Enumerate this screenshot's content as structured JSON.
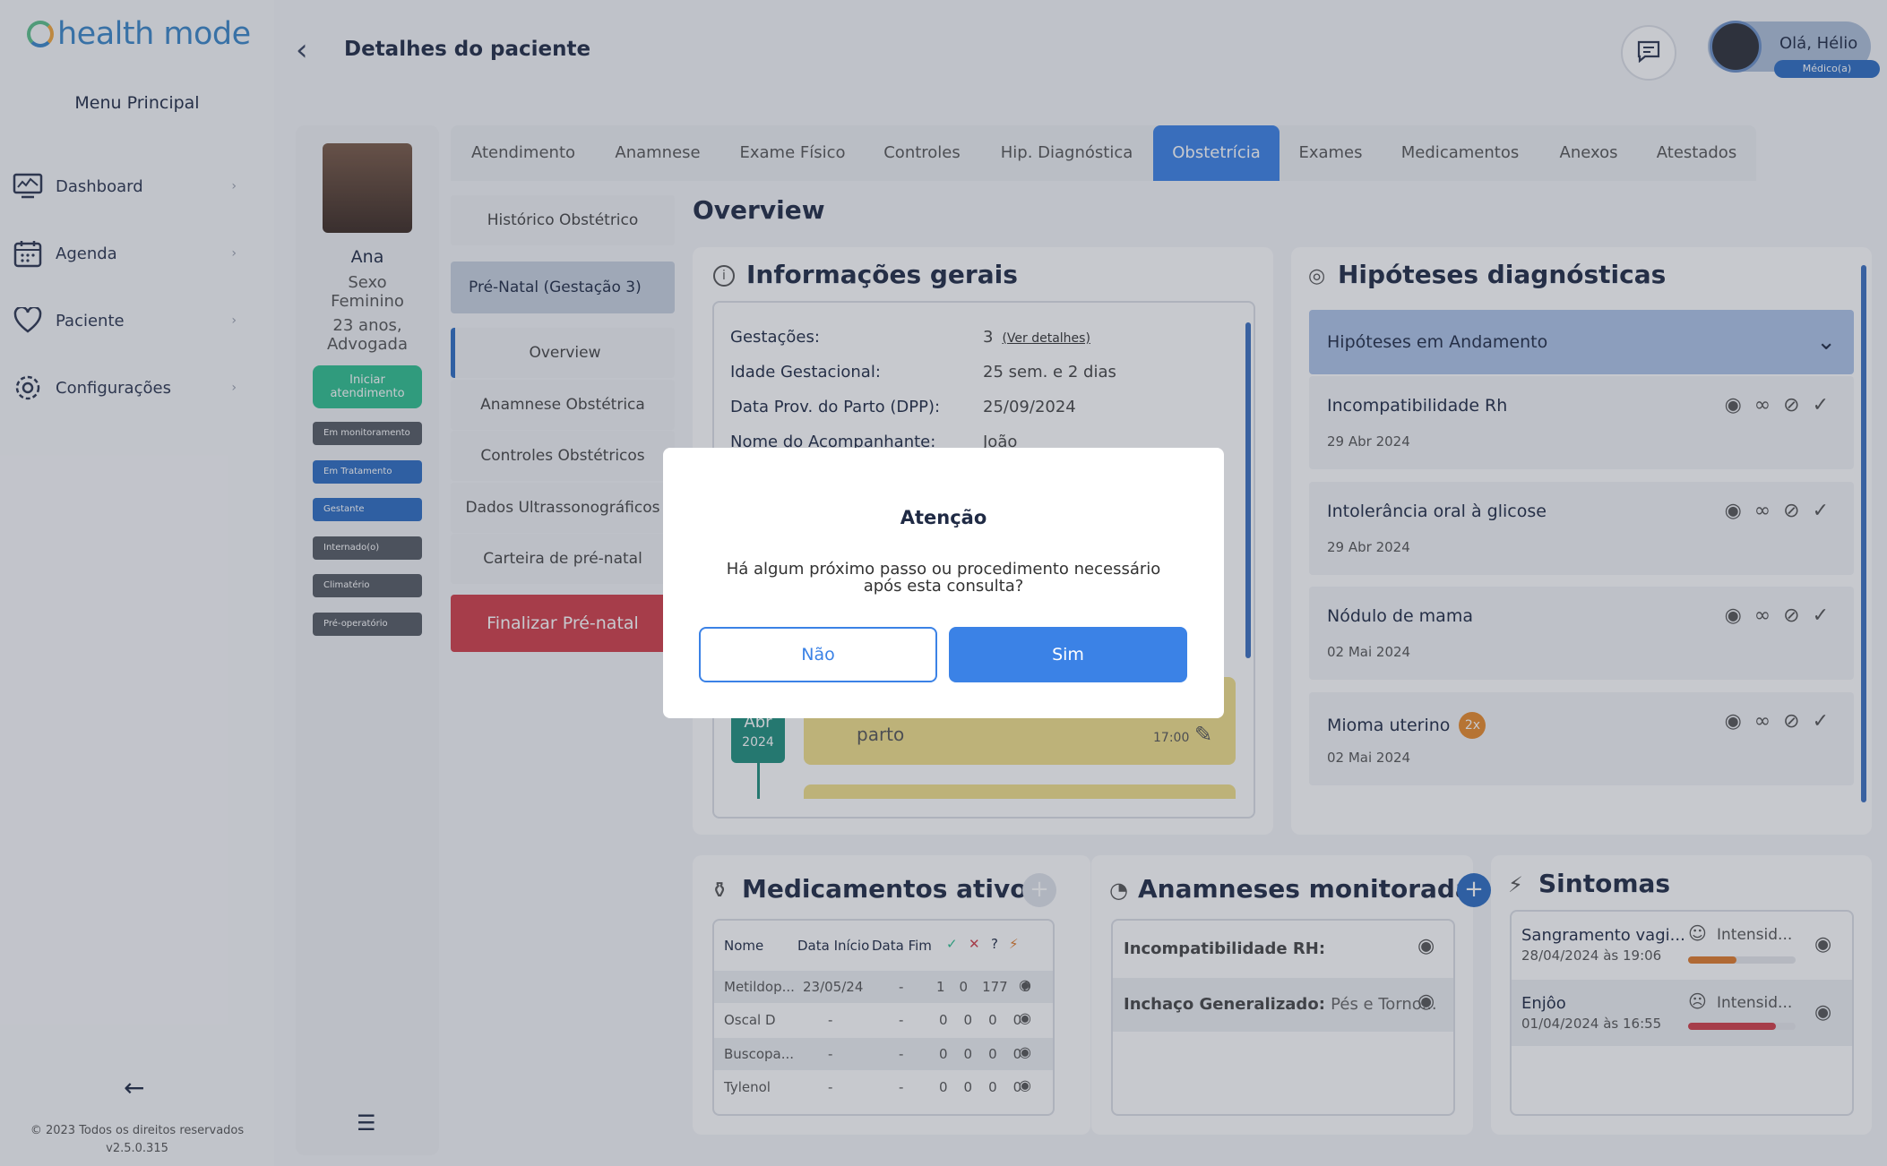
{
  "app": {
    "logo_text": "health mode",
    "menu_title": "Menu Principal"
  },
  "sidebar": {
    "items": [
      {
        "label": "Dashboard",
        "icon": "monitor-icon"
      },
      {
        "label": "Agenda",
        "icon": "calendar-icon"
      },
      {
        "label": "Paciente",
        "icon": "heart-icon"
      },
      {
        "label": "Configurações",
        "icon": "gear-icon"
      }
    ],
    "copyright": "© 2023 Todos os direitos reservados",
    "version": "v2.5.0.315"
  },
  "header": {
    "title": "Detalhes do paciente",
    "greeting": "Olá, Hélio",
    "role": "Médico(a)"
  },
  "patient": {
    "name": "Ana",
    "sex_label": "Sexo",
    "sex": "Feminino",
    "age_job": "23 anos,",
    "job": "Advogada",
    "start_button": "Iniciar atendimento",
    "tags": [
      "Em monitoramento",
      "Em Tratamento",
      "Gestante",
      "Internado(o)",
      "Climatério",
      "Pré-operatório"
    ]
  },
  "tabs": [
    "Atendimento",
    "Anamnese",
    "Exame Físico",
    "Controles",
    "Hip. Diagnóstica",
    "Obstetrícia",
    "Exames",
    "Medicamentos",
    "Anexos",
    "Atestados"
  ],
  "obst_menu": {
    "historico": "Histórico Obstétrico",
    "prenatal": "Pré-Natal (Gestação 3)",
    "items": [
      "Overview",
      "Anamnese Obstétrica",
      "Controles Obstétricos",
      "Dados Ultrassonográficos",
      "Carteira de pré-natal"
    ],
    "finalize": "Finalizar Pré-natal"
  },
  "overview": {
    "title": "Overview",
    "info_title": "Informações gerais",
    "rows": [
      {
        "label": "Gestações:",
        "value": "3",
        "link": "(Ver detalhes)"
      },
      {
        "label": "Idade Gestacional:",
        "value": "25 sem. e 2 dias"
      },
      {
        "label": "Data Prov. do Parto (DPP):",
        "value": "25/09/2024"
      },
      {
        "label": "Nome do Acompanhante:",
        "value": "João"
      }
    ],
    "timeline": {
      "month": "Abr",
      "year": "2024",
      "text": "parto",
      "time": "17:00"
    }
  },
  "hypotheses": {
    "title": "Hipóteses diagnósticas",
    "dropdown": "Hipóteses em Andamento",
    "items": [
      {
        "name": "Incompatibilidade Rh",
        "date": "29 Abr 2024"
      },
      {
        "name": "Intolerância oral à glicose",
        "date": "29 Abr 2024"
      },
      {
        "name": "Nódulo de mama",
        "date": "02 Mai 2024"
      },
      {
        "name": "Mioma uterino",
        "date": "02 Mai 2024",
        "badge": "2x"
      }
    ]
  },
  "meds": {
    "title": "Medicamentos ativos",
    "headers": [
      "Nome",
      "Data Início",
      "Data Fim",
      "✓",
      "✕",
      "?",
      "⚡"
    ],
    "rows": [
      {
        "name": "Metildop...",
        "start": "23/05/24",
        "end": "-",
        "a": "1",
        "b": "0",
        "c": "177",
        "d": "0"
      },
      {
        "name": "Oscal D",
        "start": "-",
        "end": "-",
        "a": "0",
        "b": "0",
        "c": "0",
        "d": "0"
      },
      {
        "name": "Buscopa...",
        "start": "-",
        "end": "-",
        "a": "0",
        "b": "0",
        "c": "0",
        "d": "0"
      },
      {
        "name": "Tylenol",
        "start": "-",
        "end": "-",
        "a": "0",
        "b": "0",
        "c": "0",
        "d": "0"
      }
    ]
  },
  "anamneses": {
    "title": "Anamneses monitoradas",
    "rows": [
      {
        "label": "Incompatibilidade RH:",
        "value": ""
      },
      {
        "label": "Inchaço Generalizado:",
        "value": "Pés e Torno..."
      }
    ]
  },
  "symptoms": {
    "title": "Sintomas",
    "items": [
      {
        "name": "Sangramento vagi...",
        "date": "28/04/2024 às 19:06",
        "intensity_label": "Intensid...",
        "level": 0.45,
        "color": "#e07a2a"
      },
      {
        "name": "Enjôo",
        "date": "01/04/2024 às 16:55",
        "intensity_label": "Intensid...",
        "level": 0.82,
        "color": "#d23e48"
      }
    ]
  },
  "modal": {
    "title": "Atenção",
    "message": "Há algum próximo passo ou procedimento necessário após esta consulta?",
    "no": "Não",
    "yes": "Sim"
  }
}
